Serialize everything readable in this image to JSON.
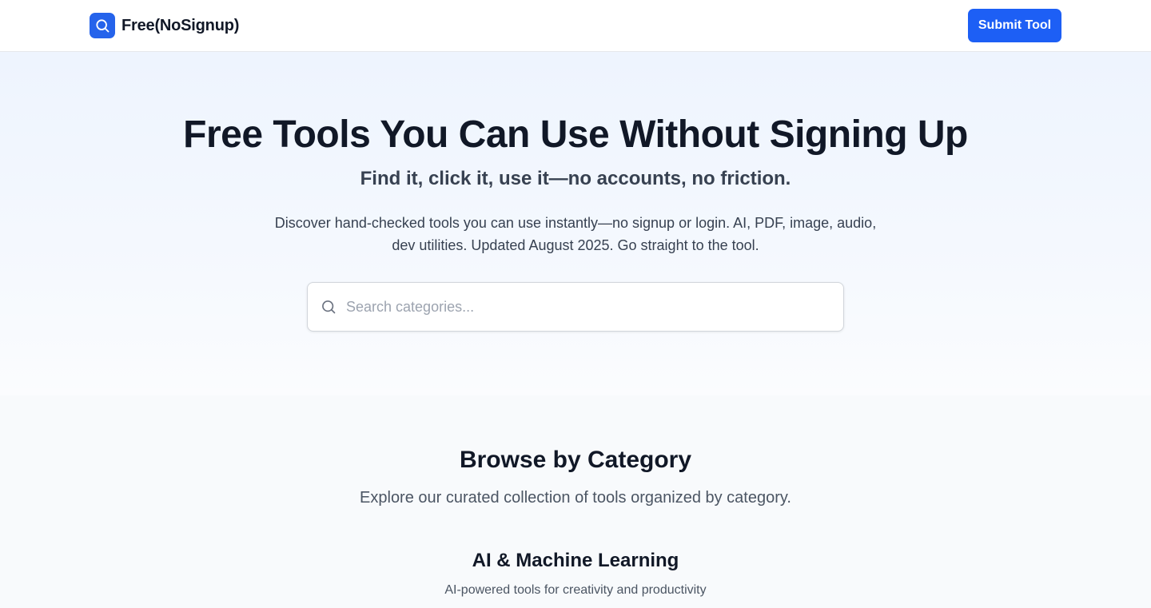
{
  "header": {
    "brand_name": "Free(NoSignup)",
    "logo_icon": "search-icon",
    "submit_label": "Submit Tool",
    "accent_color": "#1d5ff5"
  },
  "hero": {
    "title": "Free Tools You Can Use Without Signing Up",
    "subtitle": "Find it, click it, use it—no accounts, no friction.",
    "description": "Discover hand-checked tools you can use instantly—no signup or login. AI, PDF, image, audio, dev utilities. Updated August 2025. Go straight to the tool.",
    "search": {
      "placeholder": "Search categories...",
      "value": "",
      "icon": "search-icon"
    }
  },
  "categories": {
    "title": "Browse by Category",
    "subtitle": "Explore our curated collection of tools organized by category.",
    "items": [
      {
        "name": "AI & Machine Learning",
        "description": "AI-powered tools for creativity and productivity"
      }
    ]
  }
}
